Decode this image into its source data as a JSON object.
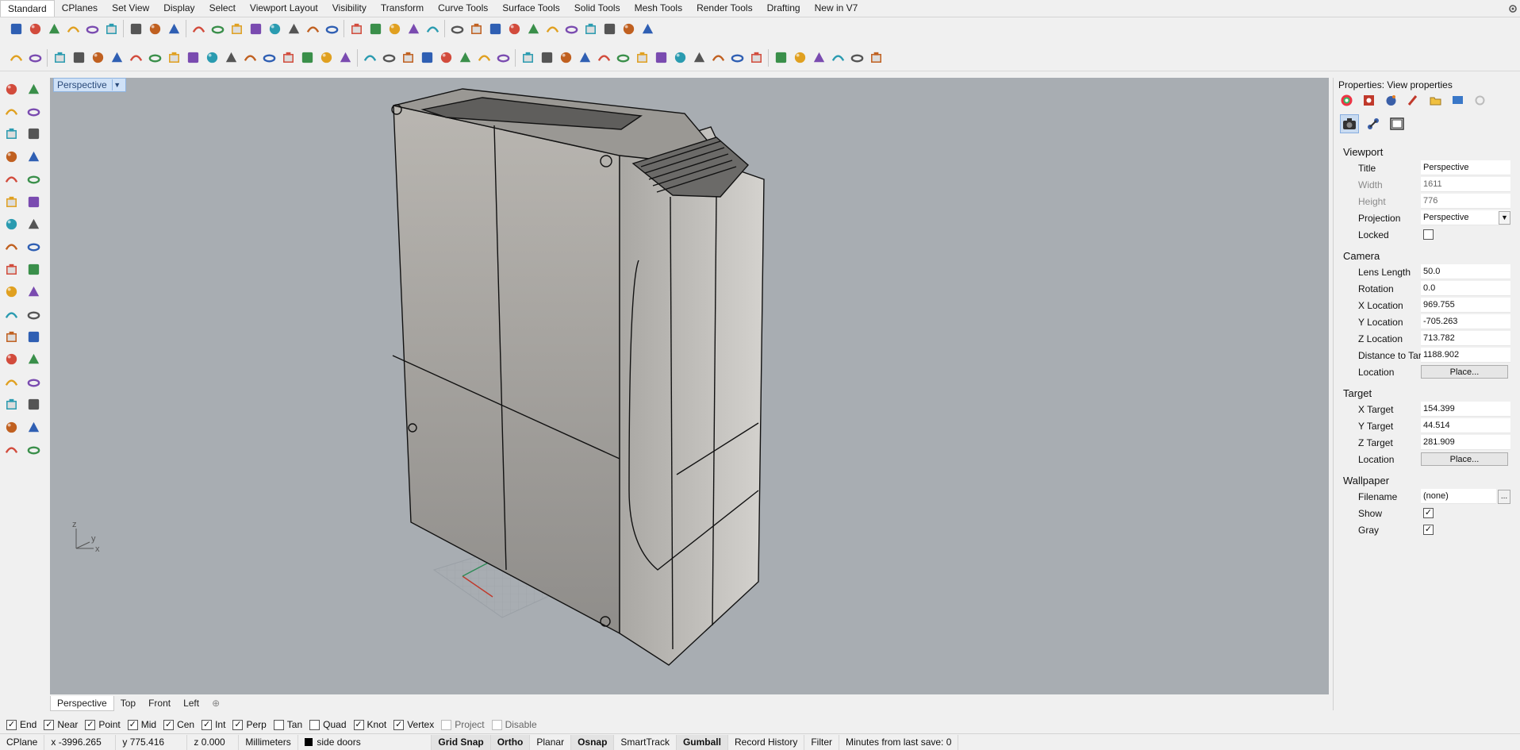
{
  "menu_tabs": [
    "Standard",
    "CPlanes",
    "Set View",
    "Display",
    "Select",
    "Viewport Layout",
    "Visibility",
    "Transform",
    "Curve Tools",
    "Surface Tools",
    "Solid Tools",
    "Mesh Tools",
    "Render Tools",
    "Drafting",
    "New in V7"
  ],
  "active_tab": "Standard",
  "toolbar1_icons": [
    "new-file-icon",
    "open-file-icon",
    "save-icon",
    "print-icon",
    "import-icon",
    "cut-icon",
    "copy-icon",
    "paste-icon",
    "undo-icon",
    "pan-icon",
    "rotate-view-icon",
    "zoom-icon",
    "zoom-window-icon",
    "zoom-extents-icon",
    "zoom-selected-icon",
    "undo-view-icon",
    "four-viewports-icon",
    "car-icon",
    "car-outline-icon",
    "snapshot-icon",
    "light-bulb-icon",
    "lock-icon",
    "layer-icon",
    "color-wheel-icon",
    "render-sphere-icon",
    "ghosted-sphere-icon",
    "xray-sphere-icon",
    "blue-sphere-icon",
    "object-properties-icon",
    "options-icon",
    "dimension-icon",
    "globe-icon",
    "help-icon"
  ],
  "toolbar2_icons": [
    "command-icon",
    "cplane-icon",
    "cone-icon",
    "sphere-half-icon",
    "cylinder-icon",
    "sphere-icon",
    "ellipsoid-icon",
    "torus-icon",
    "box-icon",
    "rotate-icon",
    "rotate-2-icon",
    "flip-icon",
    "split-icon",
    "sweep-icon",
    "sweep-2-icon",
    "solid-box-icon",
    "pipe-icon",
    "blue-box-icon",
    "orient-icon",
    "cage-icon",
    "grid-icon",
    "array-icon",
    "cup-icon",
    "transform-icon",
    "mirror-icon",
    "bubble-icon",
    "car-wash-icon",
    "steering-icon",
    "grid-box-icon",
    "weld-icon",
    "link-icon",
    "blend-icon",
    "multi-blend-icon",
    "explode-icon",
    "match-icon",
    "sphere-mesh-icon",
    "brush-icon",
    "paint-icon",
    "text-icon",
    "sphere-blue-icon",
    "point-cloud-icon",
    "sphere-yellow-icon",
    "no-entry-icon",
    "filter-icon",
    "pin-icon"
  ],
  "left_icons": [
    "select-arrow-icon",
    "point-icon",
    "polyline-icon",
    "curve-icon",
    "circle-icon",
    "ellipse-icon",
    "arc-icon",
    "rectangle-icon",
    "polygon-icon",
    "curve-tools-icon",
    "surface-icon",
    "fillet-icon",
    "box-solid-icon",
    "sphere-solid-icon",
    "cylinder-solid-icon",
    "mesh-icon",
    "edit-points-icon",
    "explode-icon",
    "trim-icon",
    "split-icon",
    "boolean-icon",
    "group-icon",
    "cage-edit-icon",
    "deform-icon",
    "text-tool-icon",
    "dimension-tool-icon",
    "block-icon",
    "transform-tool-icon",
    "array-tool-icon",
    "analyze-icon",
    "render-tool-icon",
    "check-icon",
    "material-icon",
    "paint-bucket-icon"
  ],
  "viewport": {
    "title": "Perspective",
    "axis_z": "z",
    "axis_y": "y",
    "axis_x": "x"
  },
  "viewport_tabs": [
    "Perspective",
    "Top",
    "Front",
    "Left"
  ],
  "osnaps": [
    {
      "label": "End",
      "checked": true,
      "enabled": true
    },
    {
      "label": "Near",
      "checked": true,
      "enabled": true
    },
    {
      "label": "Point",
      "checked": true,
      "enabled": true
    },
    {
      "label": "Mid",
      "checked": true,
      "enabled": true
    },
    {
      "label": "Cen",
      "checked": true,
      "enabled": true
    },
    {
      "label": "Int",
      "checked": true,
      "enabled": true
    },
    {
      "label": "Perp",
      "checked": true,
      "enabled": true
    },
    {
      "label": "Tan",
      "checked": false,
      "enabled": true
    },
    {
      "label": "Quad",
      "checked": false,
      "enabled": true
    },
    {
      "label": "Knot",
      "checked": true,
      "enabled": true
    },
    {
      "label": "Vertex",
      "checked": true,
      "enabled": true
    },
    {
      "label": "Project",
      "checked": false,
      "enabled": false
    },
    {
      "label": "Disable",
      "checked": false,
      "enabled": false
    }
  ],
  "status": {
    "cplane": "CPlane",
    "x": "x -3996.265",
    "y": "y 775.416",
    "z": "z 0.000",
    "units": "Millimeters",
    "layer": "side doors",
    "toggles": [
      {
        "label": "Grid Snap",
        "on": true
      },
      {
        "label": "Ortho",
        "on": true
      },
      {
        "label": "Planar",
        "on": false
      },
      {
        "label": "Osnap",
        "on": true
      },
      {
        "label": "SmartTrack",
        "on": false
      },
      {
        "label": "Gumball",
        "on": true
      },
      {
        "label": "Record History",
        "on": false
      },
      {
        "label": "Filter",
        "on": false
      }
    ],
    "save_info": "Minutes from last save: 0"
  },
  "properties": {
    "title": "Properties: View properties",
    "viewport_section": "Viewport",
    "title_label": "Title",
    "title_value": "Perspective",
    "width_label": "Width",
    "width_value": "1611",
    "height_label": "Height",
    "height_value": "776",
    "projection_label": "Projection",
    "projection_value": "Perspective",
    "locked_label": "Locked",
    "camera_section": "Camera",
    "lens_label": "Lens Length",
    "lens_value": "50.0",
    "rotation_label": "Rotation",
    "rotation_value": "0.0",
    "xloc_label": "X Location",
    "xloc_value": "969.755",
    "yloc_label": "Y Location",
    "yloc_value": "-705.263",
    "zloc_label": "Z Location",
    "zloc_value": "713.782",
    "dist_label": "Distance to Tar...",
    "dist_value": "1188.902",
    "location_label": "Location",
    "place_button": "Place...",
    "target_section": "Target",
    "xt_label": "X Target",
    "xt_value": "154.399",
    "yt_label": "Y Target",
    "yt_value": "44.514",
    "zt_label": "Z Target",
    "zt_value": "281.909",
    "tloc_label": "Location",
    "tplace_button": "Place...",
    "wallpaper_section": "Wallpaper",
    "filename_label": "Filename",
    "filename_value": "(none)",
    "dots_button": "...",
    "show_label": "Show",
    "gray_label": "Gray"
  },
  "colors": {
    "viewport_bg": "#a8adb2",
    "active_tab_bg": "#cfe1f7",
    "model_fill": "#b5b2ad"
  }
}
